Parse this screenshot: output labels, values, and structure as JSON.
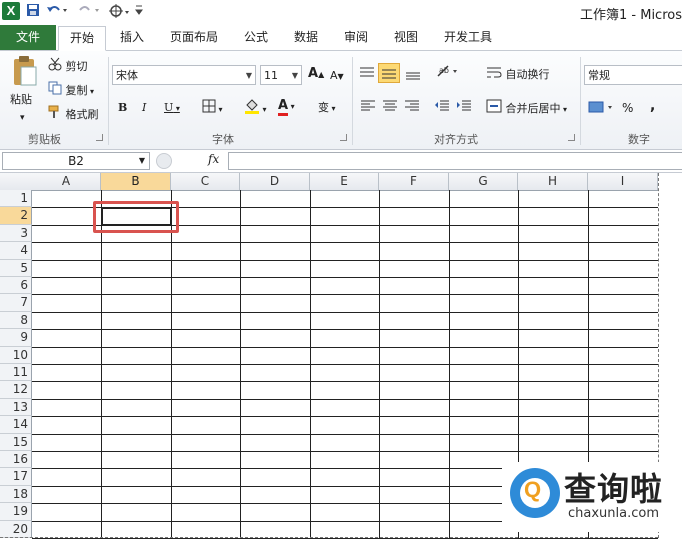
{
  "window": {
    "title": "工作簿1 - Micros"
  },
  "quick_access": [
    "save-icon",
    "undo-icon",
    "redo-icon",
    "touch-mode-icon",
    "customize-icon"
  ],
  "tabs": [
    {
      "label": "文件"
    },
    {
      "label": "开始"
    },
    {
      "label": "插入"
    },
    {
      "label": "页面布局"
    },
    {
      "label": "公式"
    },
    {
      "label": "数据"
    },
    {
      "label": "审阅"
    },
    {
      "label": "视图"
    },
    {
      "label": "开发工具"
    }
  ],
  "ribbon": {
    "clipboard": {
      "paste": "粘贴",
      "cut": "剪切",
      "copy": "复制",
      "format_painter": "格式刷",
      "group": "剪贴板"
    },
    "font": {
      "name": "宋体",
      "size": "11",
      "group": "字体",
      "bold": "B",
      "italic": "I",
      "underline": "U",
      "grow": "A",
      "shrink": "A",
      "color": "A",
      "phonetic": "变"
    },
    "alignment": {
      "wrap": "自动换行",
      "merge": "合并后居中",
      "group": "对齐方式"
    },
    "number": {
      "format": "常规",
      "percent": "%",
      "comma": ",",
      "group": "数字"
    }
  },
  "formula_bar": {
    "name_box": "B2",
    "fx": "fx",
    "value": ""
  },
  "columns": [
    "A",
    "B",
    "C",
    "D",
    "E",
    "F",
    "G",
    "H",
    "I"
  ],
  "rows": [
    "1",
    "2",
    "3",
    "4",
    "5",
    "6",
    "7",
    "8",
    "9",
    "10",
    "11",
    "12",
    "13",
    "14",
    "15",
    "16",
    "17",
    "18",
    "19",
    "20"
  ],
  "selection": {
    "cell": "B2",
    "column": "B",
    "row": "2"
  },
  "watermark": {
    "brand": "查询啦",
    "url": "chaxunla.com",
    "logo_letter": "Q"
  },
  "colors": {
    "file_tab": "#2f7a3a",
    "selected_header": "#f9d99a",
    "highlight": "#d9534f"
  }
}
